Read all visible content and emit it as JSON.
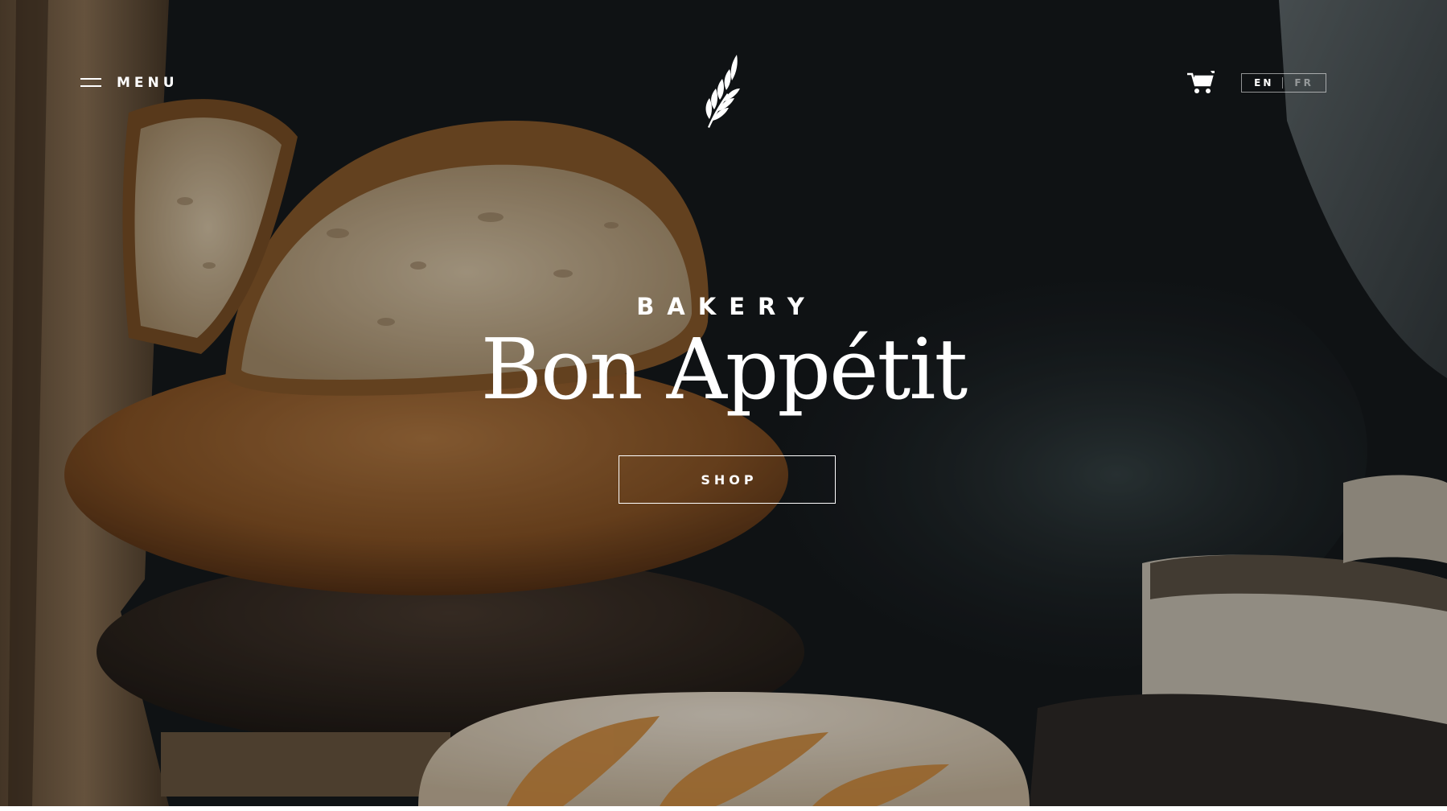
{
  "header": {
    "menu_label": "MENU",
    "languages": [
      {
        "code": "EN",
        "active": true
      },
      {
        "code": "FR",
        "active": false
      }
    ]
  },
  "hero": {
    "eyebrow": "BAKERY",
    "title": "Bon Appétit",
    "cta_label": "SHOP"
  },
  "icons": {
    "menu": "hamburger-menu-icon",
    "logo": "wheat-logo-icon",
    "cart": "shopping-cart-icon"
  },
  "colors": {
    "background_dark": "#15191c",
    "text": "#ffffff"
  }
}
